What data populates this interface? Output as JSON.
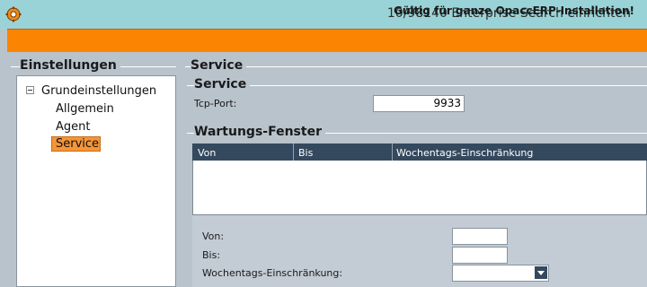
{
  "window": {
    "title": "10/98140 Enterprise Search einrichten"
  },
  "banner": {
    "text": "Gültig für ganze OpaccERP-Installation!",
    "color": "#fb8402"
  },
  "left_panel": {
    "title": "Einstellungen",
    "tree": {
      "root": "Grundeinstellungen",
      "children": [
        "Allgemein",
        "Agent",
        "Service"
      ],
      "selected": "Service"
    }
  },
  "main": {
    "section_title": "Service",
    "service_group": {
      "title": "Service",
      "port_label": "Tcp-Port:",
      "port_value": "9933"
    },
    "maintenance": {
      "title": "Wartungs-Fenster",
      "columns": [
        "Von",
        "Bis",
        "Wochentags-Einschränkung"
      ],
      "rows": []
    },
    "form": {
      "from_label": "Von:",
      "from_value": "",
      "to_label": "Bis:",
      "to_value": "",
      "weekday_label": "Wochentags-Einschränkung:",
      "weekday_value": ""
    }
  },
  "colors": {
    "titlebar": "#9ad3d7",
    "grid_header": "#34495e",
    "selection": "#f59538"
  },
  "icons": {
    "app": "gear-icon",
    "tree_toggle": "collapse-minus-icon",
    "dropdown": "chevron-down-icon"
  }
}
